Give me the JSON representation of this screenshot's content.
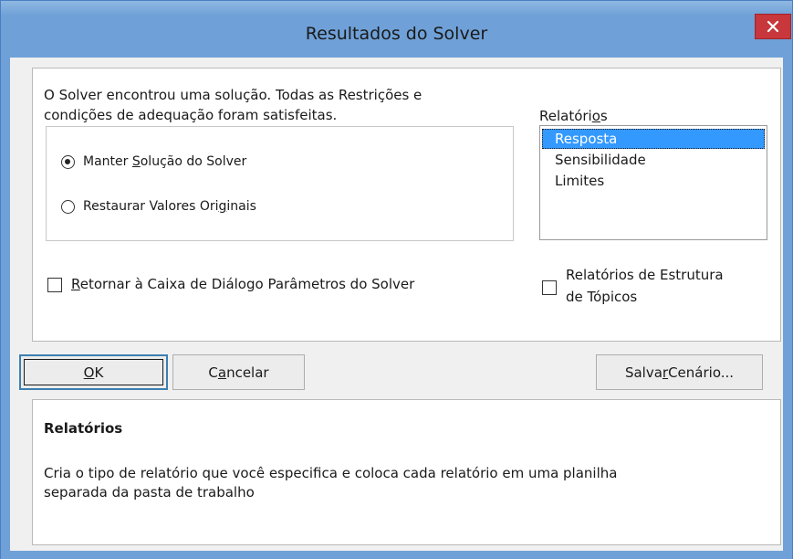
{
  "window": {
    "title": "Resultados do Solver",
    "close_icon": "close-icon"
  },
  "message": {
    "line1": "O Solver encontrou uma solução.  Todas as Restrições e",
    "line2": "condições de adequação foram satisfeitas."
  },
  "options": {
    "keep": {
      "pre": "Manter ",
      "key": "S",
      "post": "olução do Solver",
      "checked": true
    },
    "restore": {
      "pre": "Restaurar Valores Ori",
      "key": "g",
      "post": "inais",
      "checked": false
    }
  },
  "return_checkbox": {
    "pre": "",
    "key": "R",
    "post": "etornar à Caixa de Diálogo Parâmetros do Solver",
    "checked": false
  },
  "reports": {
    "label_pre": "Relatóri",
    "label_key": "o",
    "label_post": "s",
    "items": [
      "Resposta",
      "Sensibilidade",
      "Limites"
    ],
    "selected": "Resposta"
  },
  "outline_checkbox": {
    "line1": "Relatórios de Estrutura",
    "line2": "de Tópicos",
    "checked": false
  },
  "buttons": {
    "ok": {
      "key": "O",
      "post": "K"
    },
    "cancel": {
      "pre": "C",
      "key": "a",
      "post": "ncelar"
    },
    "save": {
      "pre": "Salva",
      "key": "r",
      "post": " Cenário..."
    }
  },
  "description": {
    "heading": "Relatórios",
    "line1": "Cria o tipo de relatório que você especifica e coloca cada relatório em uma planilha",
    "line2": "separada da pasta de trabalho"
  }
}
